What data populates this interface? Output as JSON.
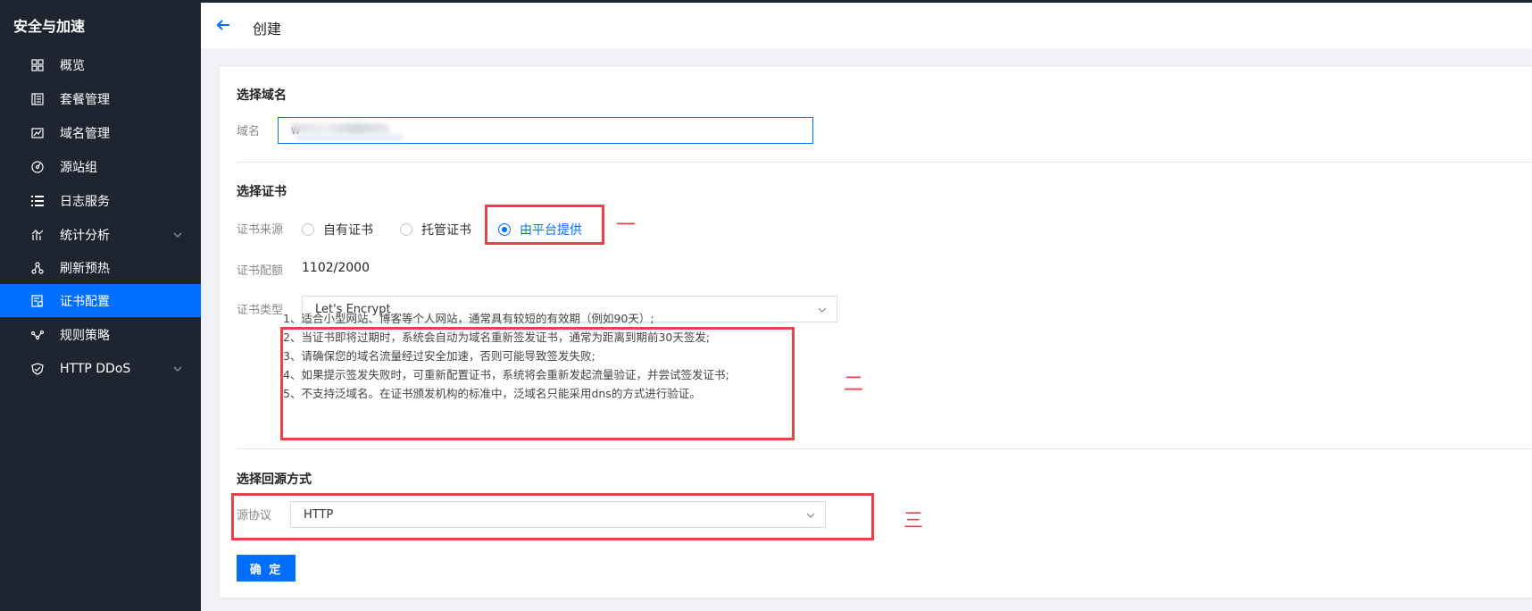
{
  "sidebar": {
    "title": "安全与加速",
    "items": [
      {
        "label": "概览",
        "icon": "grid-icon"
      },
      {
        "label": "套餐管理",
        "icon": "package-icon"
      },
      {
        "label": "域名管理",
        "icon": "domain-icon"
      },
      {
        "label": "源站组",
        "icon": "origin-icon"
      },
      {
        "label": "日志服务",
        "icon": "list-icon"
      },
      {
        "label": "统计分析",
        "icon": "chart-icon"
      },
      {
        "label": "刷新预热",
        "icon": "refresh-icon"
      },
      {
        "label": "证书配置",
        "icon": "certificate-icon"
      },
      {
        "label": "规则策略",
        "icon": "rule-icon"
      },
      {
        "label": "HTTP DDoS",
        "icon": "shield-icon"
      }
    ]
  },
  "header": {
    "title": "创建"
  },
  "domain_section": {
    "title": "选择域名",
    "label": "域名",
    "value": "w"
  },
  "cert_section": {
    "title": "选择证书",
    "source_label": "证书来源",
    "options": [
      "自有证书",
      "托管证书",
      "由平台提供"
    ],
    "selected": "由平台提供",
    "quota_label": "证书配额",
    "quota_value": "1102/2000",
    "type_label": "证书类型",
    "type_value": "Let's Encrypt",
    "notes": [
      "1、适合小型网站、博客等个人网站，通常具有较短的有效期（例如90天）;",
      "2、当证书即将过期时，系统会自动为域名重新签发证书，通常为距离到期前30天签发;",
      "3、请确保您的域名流量经过安全加速，否则可能导致签发失败;",
      "4、如果提示签发失败时，可重新配置证书，系统将会重新发起流量验证，并尝试签发证书;",
      "5、不支持泛域名。在证书颁发机构的标准中，泛域名只能采用dns的方式进行验证。"
    ]
  },
  "origin_section": {
    "title": "选择回源方式",
    "protocol_label": "源协议",
    "protocol_value": "HTTP"
  },
  "annotations": {
    "mark1": "一",
    "mark2": "二",
    "mark3": "三"
  },
  "confirm_label": "确 定",
  "colors": {
    "accent": "#006eff",
    "sidebar_bg": "#1e2530",
    "annotation": "#e8434b"
  }
}
